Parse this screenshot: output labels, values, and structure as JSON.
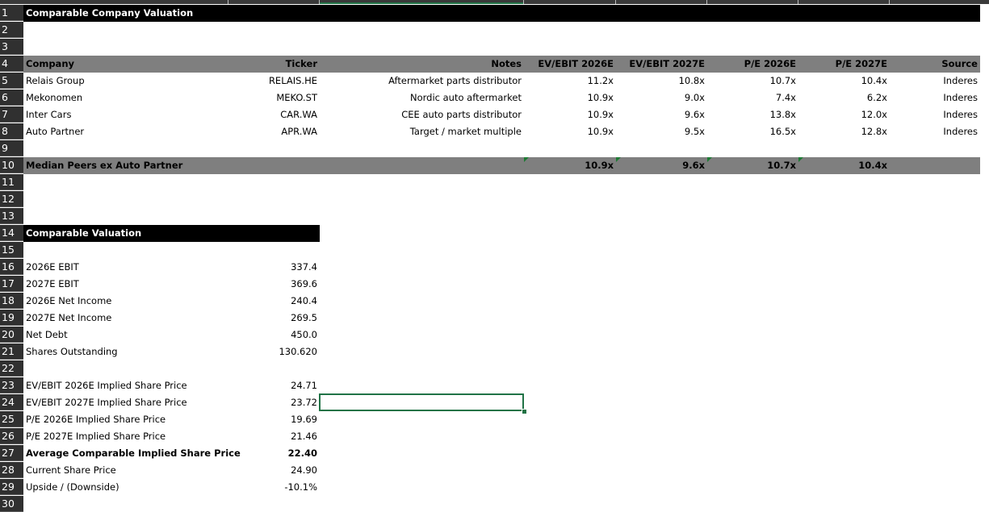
{
  "title": "Comparable Company Valuation",
  "headers": [
    "Company",
    "Ticker",
    "Notes",
    "EV/EBIT 2026E",
    "EV/EBIT 2027E",
    "P/E 2026E",
    "P/E 2027E",
    "Source"
  ],
  "peers": [
    [
      "Relais Group",
      "RELAIS.HE",
      "Aftermarket parts distributor",
      "11.2x",
      "10.8x",
      "10.7x",
      "10.4x",
      "Inderes"
    ],
    [
      "Mekonomen",
      "MEKO.ST",
      "Nordic auto aftermarket",
      "10.9x",
      "9.0x",
      "7.4x",
      "6.2x",
      "Inderes"
    ],
    [
      "Inter Cars",
      "CAR.WA",
      "CEE auto parts distributor",
      "10.9x",
      "9.6x",
      "13.8x",
      "12.0x",
      "Inderes"
    ],
    [
      "Auto Partner",
      "APR.WA",
      "Target / market multiple",
      "10.9x",
      "9.5x",
      "16.5x",
      "12.8x",
      "Inderes"
    ]
  ],
  "median": {
    "label": "Median Peers ex Auto Partner",
    "values": [
      "10.9x",
      "9.6x",
      "10.7x",
      "10.4x"
    ]
  },
  "valuation_title": "Comparable Valuation",
  "inputs": [
    [
      "2026E EBIT",
      "337.4"
    ],
    [
      "2027E EBIT",
      "369.6"
    ],
    [
      "2026E Net Income",
      "240.4"
    ],
    [
      "2027E Net Income",
      "269.5"
    ],
    [
      "Net Debt",
      "450.0"
    ],
    [
      "Shares Outstanding",
      "130.620"
    ]
  ],
  "implied": [
    [
      "EV/EBIT 2026E Implied Share Price",
      "24.71"
    ],
    [
      "EV/EBIT 2027E Implied Share Price",
      "23.72"
    ],
    [
      "P/E 2026E Implied Share Price",
      "19.69"
    ],
    [
      "P/E 2027E Implied Share Price",
      "21.46"
    ]
  ],
  "average": [
    "Average Comparable Implied Share Price",
    "22.40"
  ],
  "current": [
    "Current Share Price",
    "24.90"
  ],
  "upside": [
    "Upside / (Downside)",
    "-10.1%"
  ],
  "row_numbers": [
    "1",
    "2",
    "3",
    "4",
    "5",
    "6",
    "7",
    "8",
    "9",
    "10",
    "11",
    "12",
    "13",
    "14",
    "15",
    "16",
    "17",
    "18",
    "19",
    "20",
    "21",
    "22",
    "23",
    "24",
    "25",
    "26",
    "27",
    "28",
    "29",
    "30"
  ]
}
